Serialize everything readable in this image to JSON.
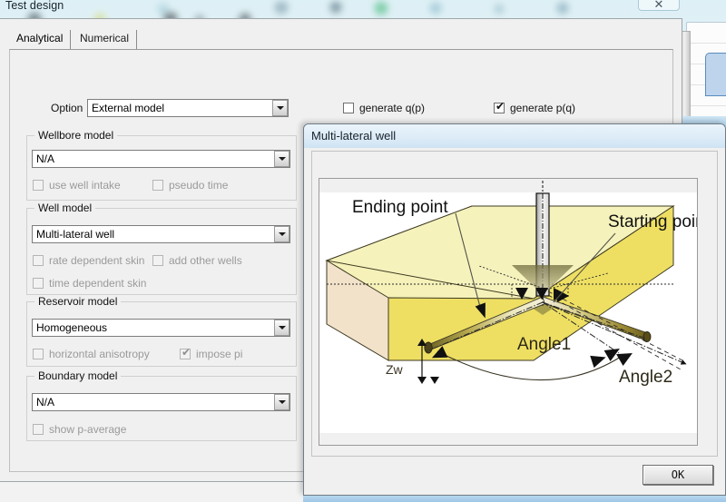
{
  "window": {
    "title": "Test design",
    "close_glyph": "✕",
    "close_name": "close-window-button"
  },
  "tabs": [
    {
      "label": "Analytical",
      "active": true
    },
    {
      "label": "Numerical",
      "active": false
    }
  ],
  "option_row": {
    "label": "Option",
    "value": "External model",
    "checkboxes": [
      {
        "label": "generate q(p)",
        "checked": false,
        "disabled": false
      },
      {
        "label": "generate p(q)",
        "checked": true,
        "disabled": false
      }
    ]
  },
  "groups": [
    {
      "caption": "Wellbore model",
      "value": "N/A",
      "checkboxes": [
        {
          "label": "use well intake",
          "checked": false,
          "disabled": true
        },
        {
          "label": "pseudo time",
          "checked": false,
          "disabled": true
        }
      ]
    },
    {
      "caption": "Well model",
      "value": "Multi-lateral well",
      "checkboxes": [
        {
          "label": "rate dependent skin",
          "checked": false,
          "disabled": true
        },
        {
          "label": "add other wells",
          "checked": false,
          "disabled": true
        },
        {
          "label": "time dependent skin",
          "checked": false,
          "disabled": true
        }
      ]
    },
    {
      "caption": "Reservoir model",
      "value": "Homogeneous",
      "checkboxes": [
        {
          "label": "horizontal anisotropy",
          "checked": false,
          "disabled": true
        },
        {
          "label": "impose pi",
          "checked": true,
          "disabled": true
        }
      ]
    },
    {
      "caption": "Boundary model",
      "value": "N/A",
      "checkboxes": [
        {
          "label": "show p-average",
          "checked": false,
          "disabled": true
        }
      ]
    }
  ],
  "dialog": {
    "title": "Multi-lateral well",
    "ok_label": "OK",
    "diagram": {
      "labels": {
        "ending_point": "Ending point",
        "starting_point": "Starting point",
        "zw": "Zw",
        "angle1": "Angle1",
        "angle2": "Angle2"
      },
      "colors": {
        "top_face": "#f2eeb4",
        "front_face": "#efdc62",
        "side_face": "#efddc8",
        "outline": "#4a4632",
        "pipe": "#d9d9d9"
      }
    }
  },
  "icons": {
    "dropdown": "chevron-down-icon",
    "check": "✔"
  }
}
